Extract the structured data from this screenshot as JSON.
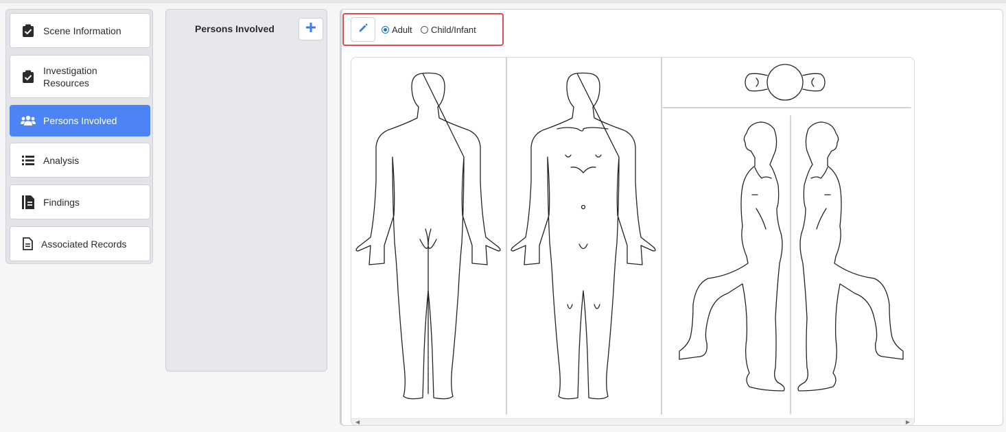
{
  "nav": {
    "items": [
      {
        "label": "Scene Information",
        "icon": "clipboard-check-icon"
      },
      {
        "label": "Investigation\nResources",
        "icon": "clipboard-check-icon"
      },
      {
        "label": "Persons Involved",
        "icon": "users-icon",
        "active": true
      },
      {
        "label": "Analysis",
        "icon": "list-icon"
      },
      {
        "label": "Findings",
        "icon": "file-text-icon"
      },
      {
        "label": "Associated Records",
        "icon": "document-icon"
      }
    ]
  },
  "persons": {
    "title": "Persons Involved",
    "add_icon": "plus-icon"
  },
  "diagram_controls": {
    "edit_icon": "pencil-icon",
    "options": [
      {
        "label": "Adult",
        "selected": true
      },
      {
        "label": "Child/Infant",
        "selected": false
      }
    ]
  },
  "colors": {
    "accent": "#4d84f5",
    "highlight": "#e04a4f"
  }
}
